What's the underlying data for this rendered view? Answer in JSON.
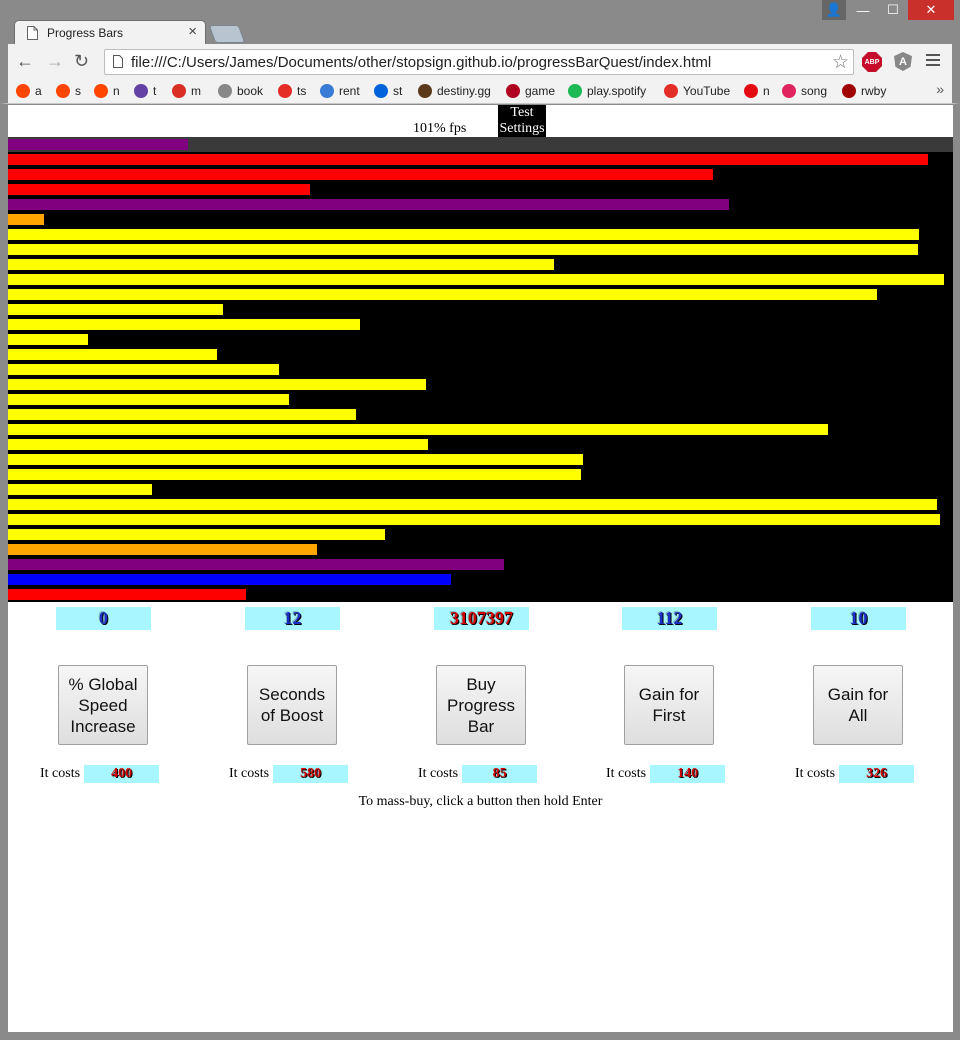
{
  "window": {
    "tab_title": "Progress Bars",
    "tab_close": "×",
    "controls": {
      "user": "👤",
      "minimize": "—",
      "maximize": "☐",
      "close": "✕"
    }
  },
  "toolbar": {
    "back": "←",
    "forward": "→",
    "reload": "↻",
    "url": "file:///C:/Users/James/Documents/other/stopsign.github.io/progressBarQuest/index.html",
    "star": "☆",
    "abp": "ABP",
    "ext_a": "A"
  },
  "bookmarks": [
    {
      "label": "a",
      "icon": "reddit-icon",
      "color": "#ff4500"
    },
    {
      "label": "s",
      "icon": "reddit-icon",
      "color": "#ff4500"
    },
    {
      "label": "n",
      "icon": "reddit-icon",
      "color": "#ff4500"
    },
    {
      "label": "t",
      "icon": "twitch-icon",
      "color": "#6441a5"
    },
    {
      "label": "m",
      "icon": "gmail-icon",
      "color": "#d93025"
    },
    {
      "label": "book",
      "icon": "page-icon",
      "color": "#888888"
    },
    {
      "label": "ts",
      "icon": "youtube-icon",
      "color": "#e52d27"
    },
    {
      "label": "rent",
      "icon": "x-icon",
      "color": "#3a7bd5"
    },
    {
      "label": "st",
      "icon": "flickr-icon",
      "color": "#0063dc"
    },
    {
      "label": "destiny.gg",
      "icon": "avatar-icon",
      "color": "#5a3a1a"
    },
    {
      "label": "game",
      "icon": "k-icon",
      "color": "#b00020"
    },
    {
      "label": "play.spotify",
      "icon": "spotify-icon",
      "color": "#1db954"
    },
    {
      "label": "YouTube",
      "icon": "youtube-icon",
      "color": "#e52d27"
    },
    {
      "label": "n",
      "icon": "netflix-icon",
      "color": "#e50914"
    },
    {
      "label": "song",
      "icon": "circle-arrow-icon",
      "color": "#e0245e"
    },
    {
      "label": "rwby",
      "icon": "rwby-icon",
      "color": "#a00000"
    }
  ],
  "bookmarks_more": "»",
  "game": {
    "fps": "101% fps",
    "test_settings": "Test Settings",
    "bars": [
      {
        "color": "#800080",
        "fill": 0.19
      },
      {
        "color": "#ff0000",
        "fill": 0.974
      },
      {
        "color": "#ff0000",
        "fill": 0.746
      },
      {
        "color": "#ff0000",
        "fill": 0.32
      },
      {
        "color": "#800080",
        "fill": 0.763
      },
      {
        "color": "#ffa500",
        "fill": 0.038
      },
      {
        "color": "#ffff00",
        "fill": 0.964
      },
      {
        "color": "#ffff00",
        "fill": 0.963
      },
      {
        "color": "#ffff00",
        "fill": 0.578
      },
      {
        "color": "#ffff00",
        "fill": 0.99
      },
      {
        "color": "#ffff00",
        "fill": 0.92
      },
      {
        "color": "#ffff00",
        "fill": 0.228
      },
      {
        "color": "#ffff00",
        "fill": 0.373
      },
      {
        "color": "#ffff00",
        "fill": 0.085
      },
      {
        "color": "#ffff00",
        "fill": 0.221
      },
      {
        "color": "#ffff00",
        "fill": 0.287
      },
      {
        "color": "#ffff00",
        "fill": 0.442
      },
      {
        "color": "#ffff00",
        "fill": 0.297
      },
      {
        "color": "#ffff00",
        "fill": 0.368
      },
      {
        "color": "#ffff00",
        "fill": 0.868
      },
      {
        "color": "#ffff00",
        "fill": 0.444
      },
      {
        "color": "#ffff00",
        "fill": 0.608
      },
      {
        "color": "#ffff00",
        "fill": 0.606
      },
      {
        "color": "#ffff00",
        "fill": 0.152
      },
      {
        "color": "#ffff00",
        "fill": 0.983
      },
      {
        "color": "#ffff00",
        "fill": 0.986
      },
      {
        "color": "#ffff00",
        "fill": 0.399
      },
      {
        "color": "#ffa500",
        "fill": 0.327
      },
      {
        "color": "#800080",
        "fill": 0.525
      },
      {
        "color": "#0000ff",
        "fill": 0.469
      },
      {
        "color": "#ff0000",
        "fill": 0.252
      }
    ],
    "stats": [
      {
        "value": "0",
        "tone": "blue"
      },
      {
        "value": "12",
        "tone": "blue"
      },
      {
        "value": "3107397",
        "tone": "red"
      },
      {
        "value": "112",
        "tone": "blue"
      },
      {
        "value": "10",
        "tone": "blue"
      }
    ],
    "buttons": [
      {
        "label": "% Global Speed Increase"
      },
      {
        "label": "Seconds of Boost"
      },
      {
        "label": "Buy Progress Bar"
      },
      {
        "label": "Gain for First"
      },
      {
        "label": "Gain for All"
      }
    ],
    "cost_label": "It costs",
    "costs": [
      "400",
      "580",
      "85",
      "140",
      "326"
    ],
    "hint": "To mass-buy, click a button then hold Enter"
  }
}
